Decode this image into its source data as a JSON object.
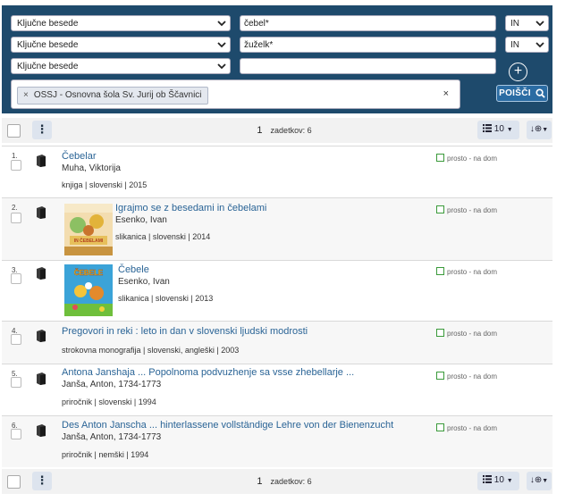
{
  "search": {
    "rows": [
      {
        "field": "Ključne besede",
        "term": "čebel*",
        "op": "IN"
      },
      {
        "field": "Ključne besede",
        "term": "žuželk*",
        "op": "IN"
      },
      {
        "field": "Ključne besede",
        "term": "",
        "op": ""
      }
    ],
    "filter_chip": "OSSJ - Osnovna šola Sv. Jurij ob Ščavnici",
    "filter_chip_remove": "×",
    "filter_clear": "×",
    "add_row": "+",
    "search_button": "POIŠČI"
  },
  "toolbar": {
    "kebab": "⋮",
    "page": "1",
    "hits_text": "zadetkov: 6",
    "per_page": "10",
    "sort_icon": "↓⊕"
  },
  "results": [
    {
      "num": "1.",
      "title": "Čebelar",
      "author": "Muha, Viktorija",
      "meta": "knjiga | slovenski | 2015",
      "availability": "prosto - na dom",
      "cover": false
    },
    {
      "num": "2.",
      "title": "Igrajmo se z besedami in čebelami",
      "author": "Esenko, Ivan",
      "meta": "slikanica | slovenski | 2014",
      "availability": "prosto - na dom",
      "cover": true,
      "cover_text": "IN ČEBELAMI"
    },
    {
      "num": "3.",
      "title": "Čebele",
      "author": "Esenko, Ivan",
      "meta": "slikanica | slovenski | 2013",
      "availability": "prosto - na dom",
      "cover": true,
      "cover_text": "ČEBELE"
    },
    {
      "num": "4.",
      "title": "Pregovori in reki : leto in dan v slovenski ljudski modrosti",
      "author": "",
      "meta": "strokovna monografija | slovenski, angleški | 2003",
      "availability": "prosto - na dom",
      "cover": false
    },
    {
      "num": "5.",
      "title": "Antona Janshaja ... Popolnoma podvuzhenje sa vsse zhebellarje ...",
      "author": "Janša, Anton, 1734-1773",
      "meta": "priročnik | slovenski | 1994",
      "availability": "prosto - na dom",
      "cover": false
    },
    {
      "num": "6.",
      "title": "Des Anton Janscha ... hinterlassene vollständige Lehre von der Bienenzucht",
      "author": "Janša, Anton, 1734-1773",
      "meta": "priročnik | nemški | 1994",
      "availability": "prosto - na dom",
      "cover": false
    }
  ],
  "colors": {
    "panel": "#1e4a6c",
    "link": "#2a6496",
    "search_button": "#2b6ca3",
    "available": "#3a9a3a"
  }
}
